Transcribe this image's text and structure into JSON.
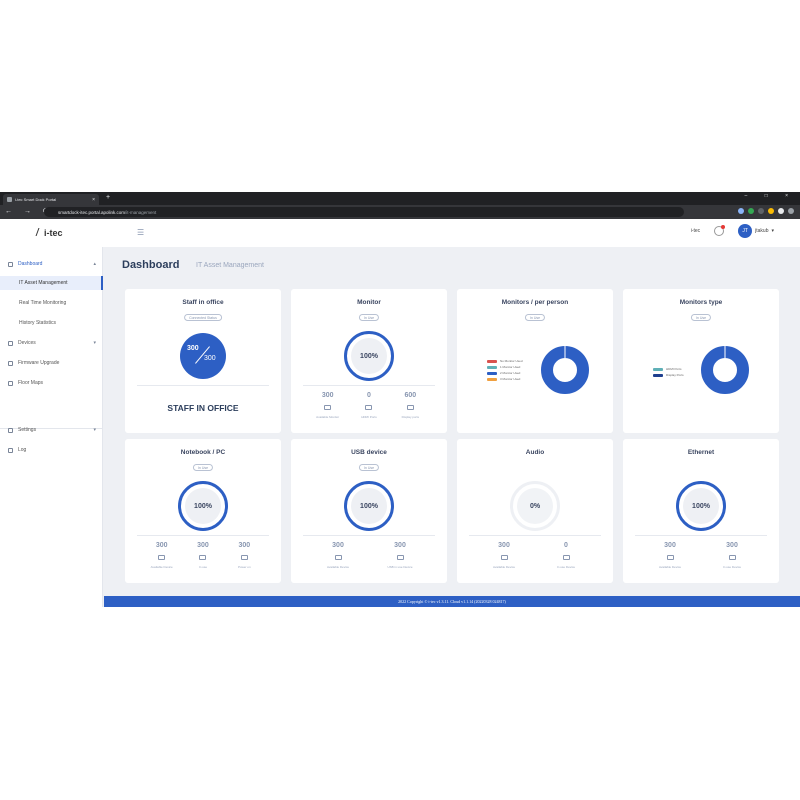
{
  "browser": {
    "tab_title": "i-tec Smart Dock Portal",
    "tab_close": "×",
    "new_tab": "+",
    "window_controls": "– □ ×",
    "nav_buttons": "← → ⟳",
    "url_host": "smartdock-itec.portal.apolink.com",
    "url_path": "/it-management"
  },
  "header": {
    "logo_text": "i-tec",
    "menu_icon": "menu-collapse-icon",
    "company": "i-tec",
    "avatar_initials": "JT",
    "user_name": "jtakub",
    "user_chevron": "▾"
  },
  "sidebar": {
    "items": [
      {
        "label": "Dashboard",
        "chev": "▴"
      },
      {
        "label": "IT Asset Management"
      },
      {
        "label": "Real Time Monitoring"
      },
      {
        "label": "History Statistics"
      },
      {
        "label": "Devices",
        "chev": "▾"
      },
      {
        "label": "Firmware Upgrade"
      },
      {
        "label": "Floor Maps"
      },
      {
        "label": "Settings",
        "chev": "▾"
      },
      {
        "label": "Log"
      }
    ]
  },
  "page": {
    "title": "Dashboard",
    "subtitle": "IT Asset Management"
  },
  "cards": {
    "staff": {
      "title": "Staff in office",
      "pill": "Connected Status",
      "present": "300",
      "total": "300",
      "label": "STAFF IN OFFICE"
    },
    "monitor": {
      "title": "Monitor",
      "pill": "In Use",
      "percent": "100%",
      "stats": [
        {
          "value": "300",
          "label": "Available Monitor"
        },
        {
          "value": "0",
          "label": "HDMI Ports"
        },
        {
          "value": "600",
          "label": "Display ports"
        }
      ]
    },
    "monitors_per_person": {
      "title": "Monitors / per person",
      "pill": "In Use",
      "legend": [
        {
          "label": "No Monitor Used",
          "color": "#d9534f"
        },
        {
          "label": "1 Monitor Used",
          "color": "#5fb0b7"
        },
        {
          "label": "2 Monitor Used",
          "color": "#2d5fc4"
        },
        {
          "label": "3 Monitor Used",
          "color": "#f0a040"
        }
      ]
    },
    "monitors_type": {
      "title": "Monitors type",
      "pill": "In Use",
      "legend": [
        {
          "label": "HDMI Ports",
          "color": "#5fb0b7"
        },
        {
          "label": "Display Ports",
          "color": "#1f3f8f"
        }
      ]
    },
    "notebook": {
      "title": "Notebook / PC",
      "pill": "In Use",
      "percent": "100%",
      "stats": [
        {
          "value": "300",
          "label": "Available Device"
        },
        {
          "value": "300",
          "label": "In use"
        },
        {
          "value": "300",
          "label": "Power on"
        }
      ]
    },
    "usb": {
      "title": "USB device",
      "pill": "In Use",
      "percent": "100%",
      "stats": [
        {
          "value": "300",
          "label": "Available Device"
        },
        {
          "value": "300",
          "label": "USB in use Device"
        }
      ]
    },
    "audio": {
      "title": "Audio",
      "pill": "",
      "percent": "0%",
      "stats": [
        {
          "value": "300",
          "label": "Available Device"
        },
        {
          "value": "0",
          "label": "In use Device"
        }
      ]
    },
    "ethernet": {
      "title": "Ethernet",
      "pill": "",
      "percent": "100%",
      "stats": [
        {
          "value": "300",
          "label": "Available Device"
        },
        {
          "value": "300",
          "label": "In use Device"
        }
      ]
    }
  },
  "footer": {
    "text": "2022 Copyright © i-tec   v1.3.11. Cloud   v1.1.14 (20220328 024817)"
  },
  "colors": {
    "accent": "#2d5fc4",
    "ring_track": "#eef0f4"
  }
}
